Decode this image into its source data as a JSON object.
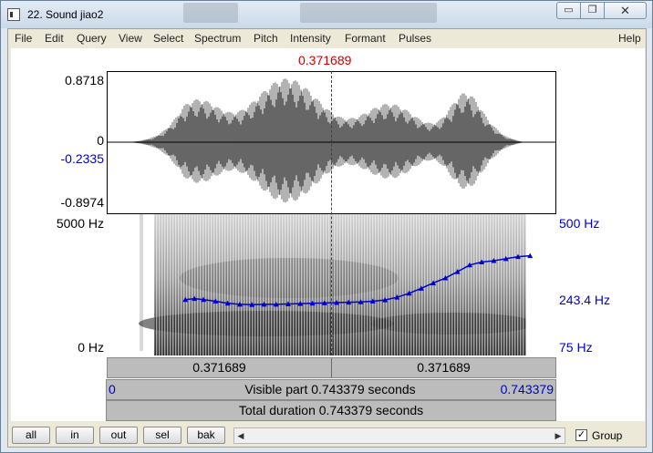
{
  "window": {
    "title": "22. Sound jiao2",
    "minimize_glyph": "▭",
    "maximize_glyph": "❐",
    "close_glyph": "✕"
  },
  "menu": [
    "File",
    "Edit",
    "Query",
    "View",
    "Select",
    "Spectrum",
    "Pitch",
    "Intensity",
    "Formant",
    "Pulses"
  ],
  "help_label": "Help",
  "cursor": {
    "time_label": "0.371689",
    "time": 0.371689
  },
  "waveform": {
    "y_max": "0.8718",
    "y_zero": "0",
    "y_value": "-0.2335",
    "y_min": "-0.8974"
  },
  "spectrogram": {
    "freq_top": "5000 Hz",
    "freq_bottom": "0 Hz",
    "pitch_top": "500 Hz",
    "pitch_value": "243.4 Hz",
    "pitch_bottom": "75 Hz",
    "duration": 0.743379,
    "pitch_track": [
      [
        0.13,
        243
      ],
      [
        0.145,
        246
      ],
      [
        0.16,
        243
      ],
      [
        0.18,
        238
      ],
      [
        0.2,
        232
      ],
      [
        0.22,
        229
      ],
      [
        0.24,
        228
      ],
      [
        0.26,
        229
      ],
      [
        0.28,
        229
      ],
      [
        0.3,
        230
      ],
      [
        0.32,
        231
      ],
      [
        0.34,
        232
      ],
      [
        0.36,
        233
      ],
      [
        0.38,
        234
      ],
      [
        0.4,
        235
      ],
      [
        0.42,
        236
      ],
      [
        0.44,
        238
      ],
      [
        0.46,
        242
      ],
      [
        0.48,
        250
      ],
      [
        0.5,
        262
      ],
      [
        0.52,
        277
      ],
      [
        0.54,
        293
      ],
      [
        0.56,
        308
      ],
      [
        0.58,
        327
      ],
      [
        0.6,
        347
      ],
      [
        0.62,
        356
      ],
      [
        0.64,
        360
      ],
      [
        0.66,
        366
      ],
      [
        0.68,
        372
      ],
      [
        0.7,
        375
      ]
    ]
  },
  "time_bar": {
    "left_label": "0.371689",
    "right_label": "0.371689",
    "start_label": "0",
    "visible_label": "Visible part 0.743379 seconds",
    "end_label": "0.743379",
    "total_label": "Total duration 0.743379 seconds"
  },
  "buttons": {
    "all": "all",
    "in": "in",
    "out": "out",
    "sel": "sel",
    "bak": "bak"
  },
  "scroll": {
    "left_arrow": "◀",
    "right_arrow": "▶"
  },
  "group": {
    "label": "Group",
    "checked": true,
    "check_glyph": "✓"
  },
  "colors": {
    "cursor": "#d00000",
    "pitch": "#0000d0"
  }
}
